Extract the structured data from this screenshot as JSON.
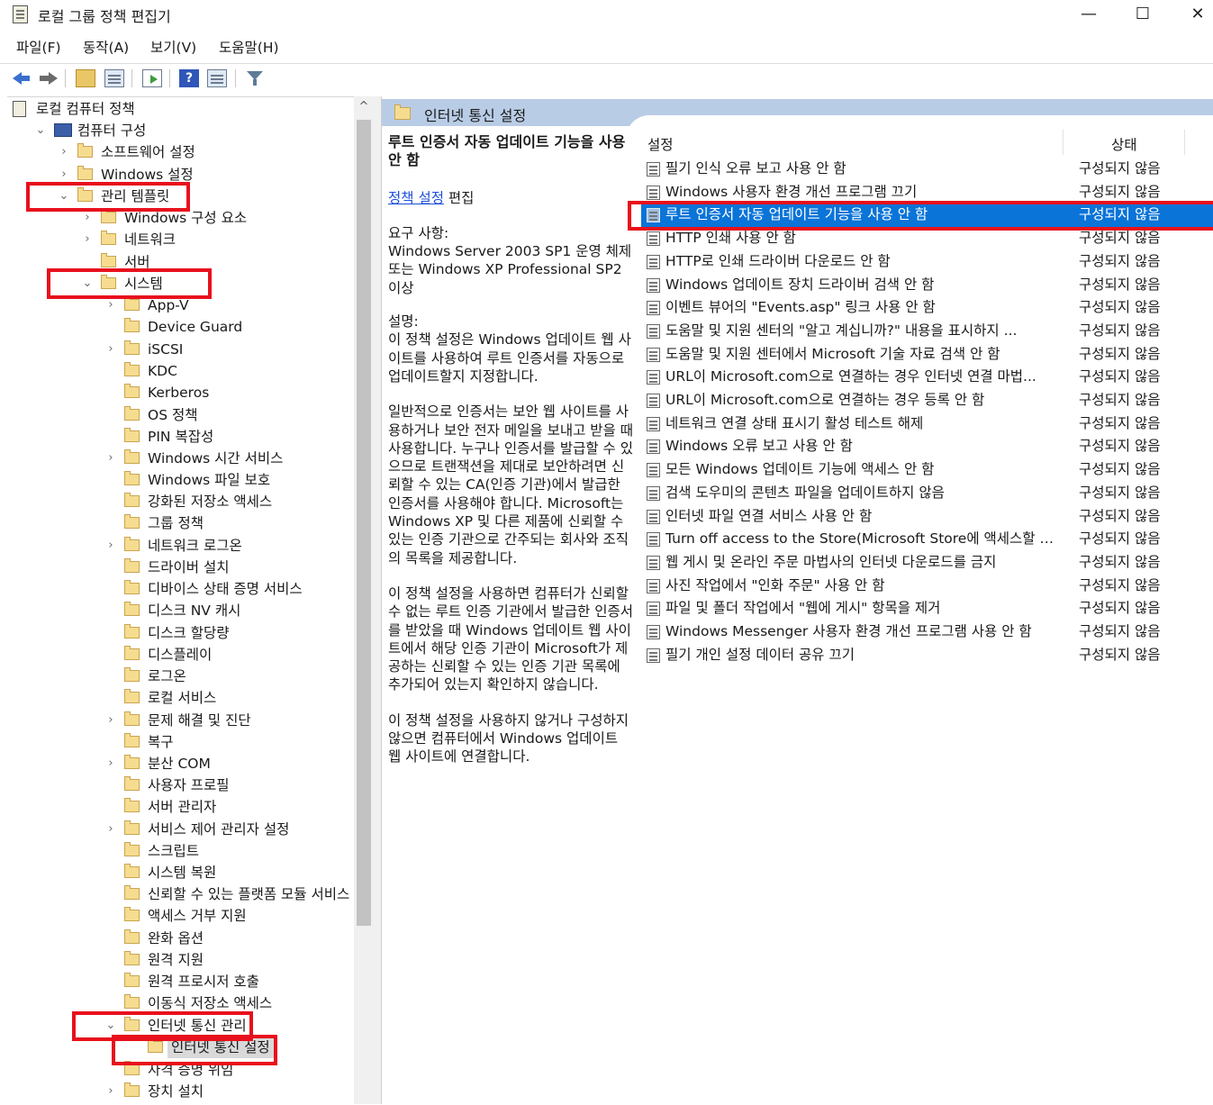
{
  "window": {
    "title": "로컬 그룹 정책 편집기",
    "controls": [
      "—",
      "☐",
      "✕"
    ]
  },
  "menu": [
    "파일(F)",
    "동작(A)",
    "보기(V)",
    "도움말(H)"
  ],
  "toolbar": {
    "icons": [
      "back-arrow-icon",
      "forward-arrow-icon",
      "up-folder-icon",
      "show-hide-tree-icon",
      "export-list-icon",
      "help-icon",
      "extended-view-icon",
      "filter-icon"
    ],
    "help_glyph": "?"
  },
  "tree": [
    {
      "label": "로컬 컴퓨터 정책",
      "expander": "",
      "icon": "doc"
    },
    {
      "label": "컴퓨터 구성",
      "expander": "⌄",
      "icon": "pc"
    },
    {
      "label": "소프트웨어 설정",
      "expander": "›",
      "icon": "folder"
    },
    {
      "label": "Windows 설정",
      "expander": "›",
      "icon": "folder"
    },
    {
      "label": "관리 템플릿",
      "expander": "⌄",
      "icon": "folder"
    },
    {
      "label": "Windows 구성 요소",
      "expander": "›",
      "icon": "folder"
    },
    {
      "label": "네트워크",
      "expander": "›",
      "icon": "folder"
    },
    {
      "label": "서버",
      "expander": "",
      "icon": "folder"
    },
    {
      "label": "시스템",
      "expander": "⌄",
      "icon": "folder"
    },
    {
      "label": "App-V",
      "expander": "›",
      "icon": "folder"
    },
    {
      "label": "Device Guard",
      "expander": "",
      "icon": "folder"
    },
    {
      "label": "iSCSI",
      "expander": "›",
      "icon": "folder"
    },
    {
      "label": "KDC",
      "expander": "",
      "icon": "folder"
    },
    {
      "label": "Kerberos",
      "expander": "",
      "icon": "folder"
    },
    {
      "label": "OS 정책",
      "expander": "",
      "icon": "folder"
    },
    {
      "label": "PIN 복잡성",
      "expander": "",
      "icon": "folder"
    },
    {
      "label": "Windows 시간 서비스",
      "expander": "›",
      "icon": "folder"
    },
    {
      "label": "Windows 파일 보호",
      "expander": "",
      "icon": "folder"
    },
    {
      "label": "강화된 저장소 액세스",
      "expander": "",
      "icon": "folder"
    },
    {
      "label": "그룹 정책",
      "expander": "",
      "icon": "folder"
    },
    {
      "label": "네트워크 로그온",
      "expander": "›",
      "icon": "folder"
    },
    {
      "label": "드라이버 설치",
      "expander": "",
      "icon": "folder"
    },
    {
      "label": "디바이스 상태 증명 서비스",
      "expander": "",
      "icon": "folder"
    },
    {
      "label": "디스크 NV 캐시",
      "expander": "",
      "icon": "folder"
    },
    {
      "label": "디스크 할당량",
      "expander": "",
      "icon": "folder"
    },
    {
      "label": "디스플레이",
      "expander": "",
      "icon": "folder"
    },
    {
      "label": "로그온",
      "expander": "",
      "icon": "folder"
    },
    {
      "label": "로컬 서비스",
      "expander": "",
      "icon": "folder"
    },
    {
      "label": "문제 해결 및 진단",
      "expander": "›",
      "icon": "folder"
    },
    {
      "label": "복구",
      "expander": "",
      "icon": "folder"
    },
    {
      "label": "분산 COM",
      "expander": "›",
      "icon": "folder"
    },
    {
      "label": "사용자 프로필",
      "expander": "",
      "icon": "folder"
    },
    {
      "label": "서버 관리자",
      "expander": "",
      "icon": "folder"
    },
    {
      "label": "서비스 제어 관리자 설정",
      "expander": "›",
      "icon": "folder"
    },
    {
      "label": "스크립트",
      "expander": "",
      "icon": "folder"
    },
    {
      "label": "시스템 복원",
      "expander": "",
      "icon": "folder"
    },
    {
      "label": "신뢰할 수 있는 플랫폼 모듈 서비스",
      "expander": "",
      "icon": "folder"
    },
    {
      "label": "액세스 거부 지원",
      "expander": "",
      "icon": "folder"
    },
    {
      "label": "완화 옵션",
      "expander": "",
      "icon": "folder"
    },
    {
      "label": "원격 지원",
      "expander": "",
      "icon": "folder"
    },
    {
      "label": "원격 프로시저 호출",
      "expander": "",
      "icon": "folder"
    },
    {
      "label": "이동식 저장소 액세스",
      "expander": "",
      "icon": "folder"
    },
    {
      "label": "인터넷 통신 관리",
      "expander": "⌄",
      "icon": "folder"
    },
    {
      "label": "인터넷 통신 설정",
      "expander": "",
      "icon": "folder"
    },
    {
      "label": "자격 증명 위임",
      "expander": "",
      "icon": "folder"
    },
    {
      "label": "장치 설치",
      "expander": "›",
      "icon": "folder"
    }
  ],
  "content_header": {
    "title": "인터넷 통신 설정"
  },
  "description": {
    "policy_title": "루트 인증서 자동 업데이트 기능을 사용 안 함",
    "edit_link": "정책 설정",
    "edit_suffix": " 편집",
    "requirements_label": "요구 사항:",
    "requirements_text": "Windows Server 2003 SP1 운영 체제 또는 Windows XP Professional SP2 이상",
    "description_label": "설명:",
    "paragraphs": [
      "이 정책 설정은 Windows 업데이트 웹 사이트를 사용하여 루트 인증서를 자동으로 업데이트할지 지정합니다.",
      "일반적으로 인증서는 보안 웹 사이트를 사용하거나 보안 전자 메일을 보내고 받을 때 사용합니다. 누구나 인증서를 발급할 수 있으므로 트랜잭션을 제대로 보안하려면 신뢰할 수 있는 CA(인증 기관)에서 발급한 인증서를 사용해야 합니다. Microsoft는 Windows XP 및 다른 제품에 신뢰할 수 있는 인증 기관으로 간주되는 회사와 조직의 목록을 제공합니다.",
      "이 정책 설정을 사용하면 컴퓨터가 신뢰할 수 없는 루트 인증 기관에서 발급한 인증서를 받았을 때 Windows 업데이트 웹 사이트에서 해당 인증 기관이 Microsoft가 제공하는 신뢰할 수 있는 인증 기관 목록에 추가되어 있는지 확인하지 않습니다.",
      "이 정책 설정을 사용하지 않거나 구성하지 않으면 컴퓨터에서 Windows 업데이트 웹 사이트에 연결합니다."
    ]
  },
  "list": {
    "col_setting": "설정",
    "col_state": "상태",
    "rows": [
      {
        "name": "필기 인식 오류 보고 사용 안 함",
        "state": "구성되지 않음"
      },
      {
        "name": "Windows 사용자 환경 개선 프로그램 끄기",
        "state": "구성되지 않음"
      },
      {
        "name": "루트 인증서 자동 업데이트 기능을 사용 안 함",
        "state": "구성되지 않음"
      },
      {
        "name": "HTTP 인쇄 사용 안 함",
        "state": "구성되지 않음"
      },
      {
        "name": "HTTP로 인쇄 드라이버 다운로드 안 함",
        "state": "구성되지 않음"
      },
      {
        "name": "Windows 업데이트 장치 드라이버 검색 안 함",
        "state": "구성되지 않음"
      },
      {
        "name": "이벤트 뷰어의 \"Events.asp\" 링크 사용 안 함",
        "state": "구성되지 않음"
      },
      {
        "name": "도움말 및 지원 센터의 \"알고 계십니까?\" 내용을 표시하지 ...",
        "state": "구성되지 않음"
      },
      {
        "name": "도움말 및 지원 센터에서 Microsoft 기술 자료 검색 안 함",
        "state": "구성되지 않음"
      },
      {
        "name": "URL이 Microsoft.com으로 연결하는 경우 인터넷 연결 마법...",
        "state": "구성되지 않음"
      },
      {
        "name": "URL이 Microsoft.com으로 연결하는 경우 등록 안 함",
        "state": "구성되지 않음"
      },
      {
        "name": "네트워크 연결 상태 표시기 활성 테스트 해제",
        "state": "구성되지 않음"
      },
      {
        "name": "Windows 오류 보고 사용 안 함",
        "state": "구성되지 않음"
      },
      {
        "name": "모든 Windows 업데이트 기능에 액세스 안 함",
        "state": "구성되지 않음"
      },
      {
        "name": "검색 도우미의 콘텐츠 파일을 업데이트하지 않음",
        "state": "구성되지 않음"
      },
      {
        "name": "인터넷 파일 연결 서비스 사용 안 함",
        "state": "구성되지 않음"
      },
      {
        "name": "Turn off access to the Store(Microsoft Store에 액세스할 수...",
        "state": "구성되지 않음"
      },
      {
        "name": "웹 게시 및 온라인 주문 마법사의 인터넷 다운로드를 금지",
        "state": "구성되지 않음"
      },
      {
        "name": "사진 작업에서 \"인화 주문\" 사용 안 함",
        "state": "구성되지 않음"
      },
      {
        "name": "파일 및 폴더 작업에서 \"웹에 게시\" 항목을 제거",
        "state": "구성되지 않음"
      },
      {
        "name": "Windows Messenger 사용자 환경 개선 프로그램 사용 안 함",
        "state": "구성되지 않음"
      },
      {
        "name": "필기 개인 설정 데이터 공유 끄기",
        "state": "구성되지 않음"
      }
    ]
  },
  "colors": {
    "selection": "#0a74d8",
    "highlight_box": "#e8101c",
    "header_band": "#b9cce6"
  }
}
